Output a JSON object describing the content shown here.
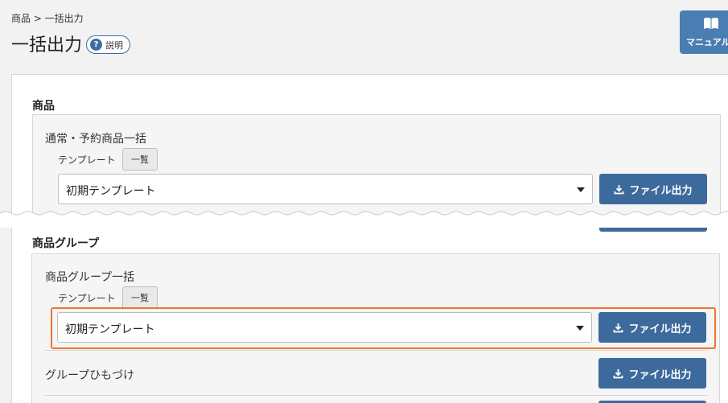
{
  "breadcrumb": "商品 > 一括出力",
  "page_title": "一括出力",
  "help_label": "説明",
  "help_icon": "question-icon",
  "manual_label": "マニュアル",
  "manual_icon": "book-icon",
  "sections": {
    "product": {
      "title": "商品",
      "card_heading": "通常・予約商品一括",
      "template_label": "テンプレート",
      "list_button": "一覧",
      "selected_template": "初期テンプレート",
      "export_label": "ファイル出力"
    },
    "group": {
      "title": "商品グループ",
      "card_heading": "商品グループ一括",
      "template_label": "テンプレート",
      "list_button": "一覧",
      "selected_template": "初期テンプレート",
      "export_label": "ファイル出力",
      "link_row_label": "グループひもづけ",
      "link_export_label": "ファイル出力"
    }
  },
  "colors": {
    "primary": "#3d6a9c",
    "manual": "#4a7eb3",
    "highlight": "#ee7330",
    "background": "#f2f2f2"
  }
}
